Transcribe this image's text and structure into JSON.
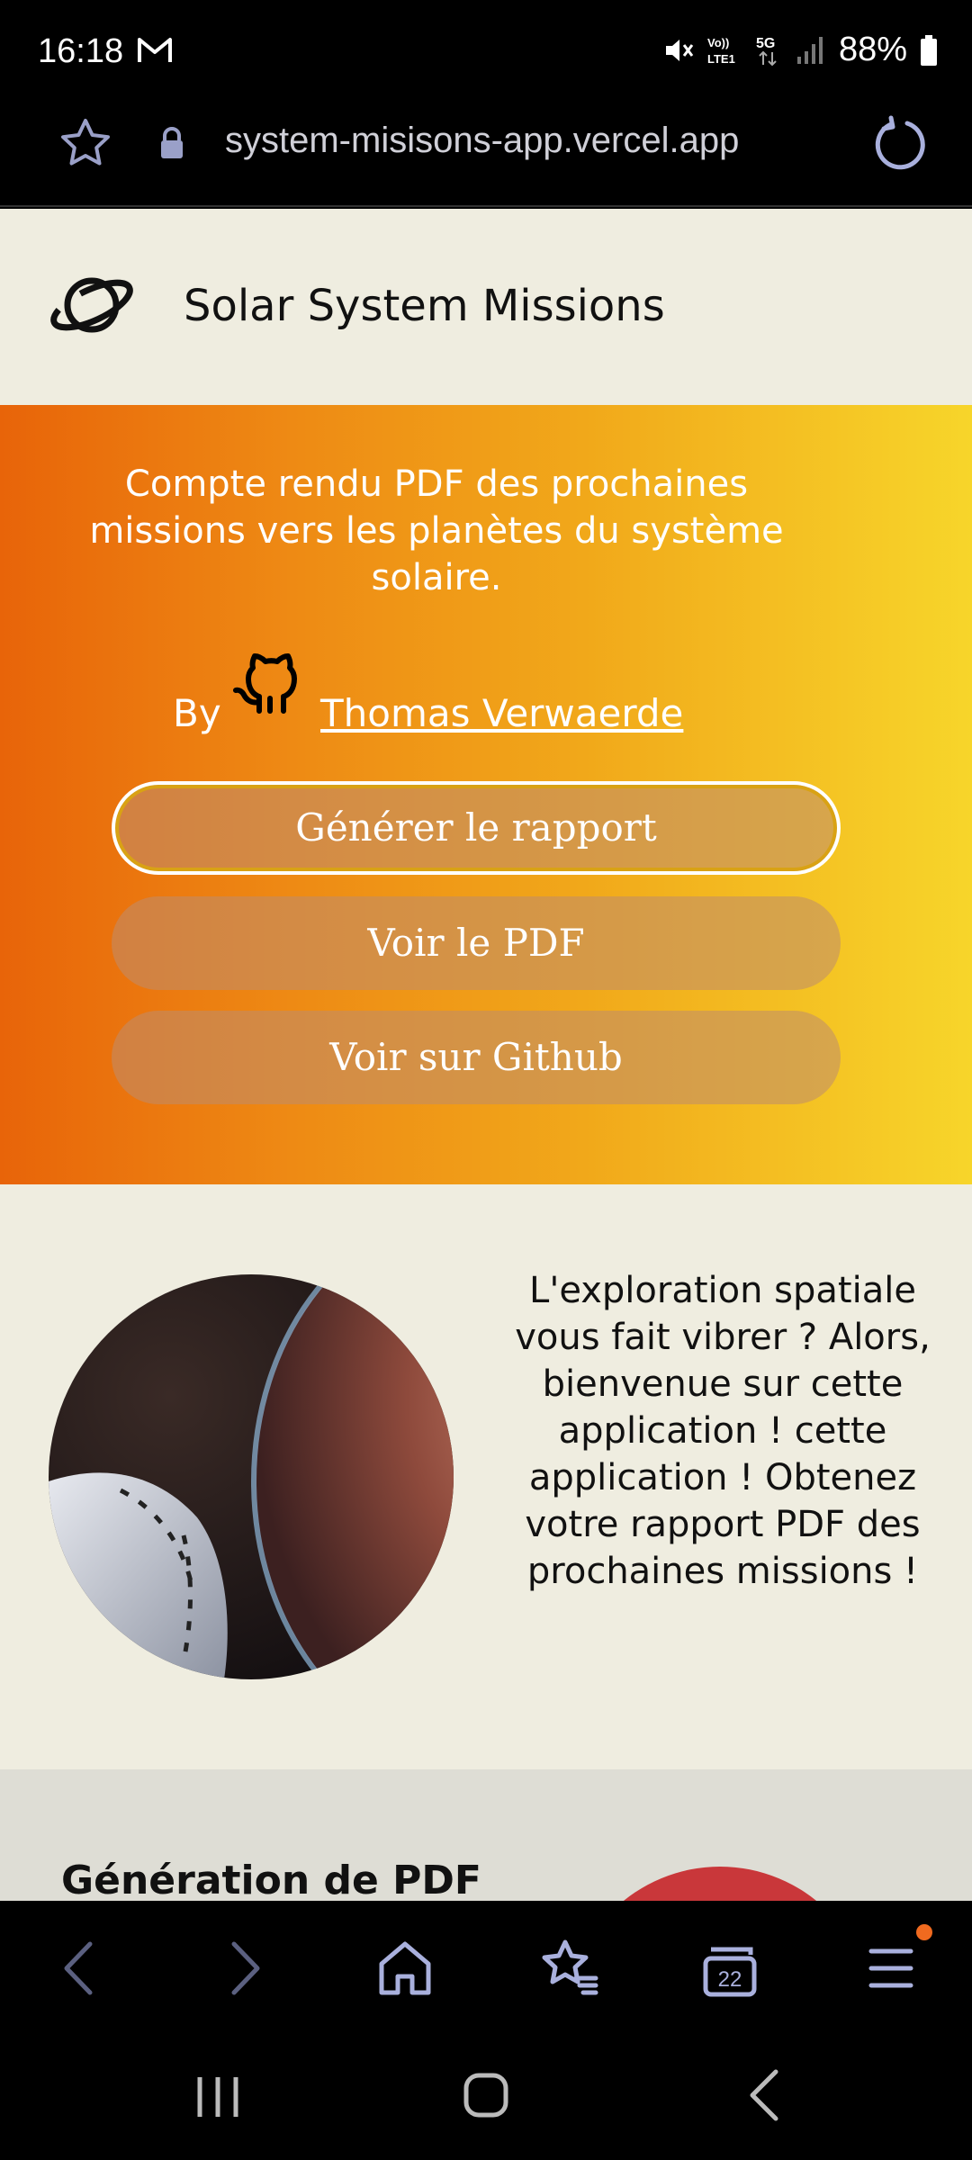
{
  "status_bar": {
    "time": "16:18",
    "battery": "88%",
    "network_lte": "Vo) LTE1",
    "network_5g": "5G"
  },
  "browser": {
    "url": "system-misisons-app.vercel.app",
    "tab_count": "22"
  },
  "header": {
    "title": "Solar System Missions"
  },
  "hero": {
    "description": "Compte rendu PDF des prochaines missions vers les planètes du système solaire.",
    "by_label": "By",
    "author": " Thomas Verwaerde",
    "buttons": {
      "generate": "Générer le rapport",
      "view_pdf": "Voir le PDF",
      "github": "Voir sur Github"
    }
  },
  "intro": {
    "text": "L'exploration spatiale vous fait vibrer ? Alors, bienvenue sur cette application ! cette application ! Obtenez votre rapport PDF des prochaines missions !"
  },
  "section2": {
    "title": "Génération de PDF"
  },
  "colors": {
    "hero_start": "#e86409",
    "hero_end": "#f7d52a",
    "page_bg": "#efede0",
    "accent_red": "#c9373a",
    "notification_dot": "#f06a1f"
  }
}
